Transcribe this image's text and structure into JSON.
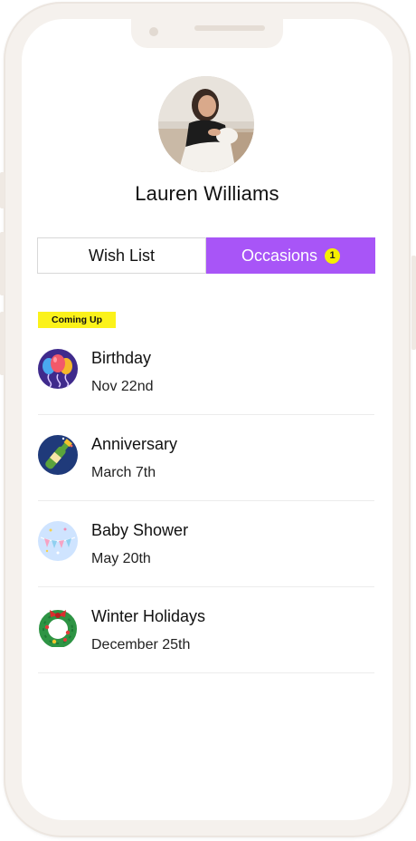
{
  "profile": {
    "name": "Lauren Williams"
  },
  "tabs": {
    "wish_list": "Wish List",
    "occasions": "Occasions",
    "occasions_badge": "1"
  },
  "section_label": "Coming Up",
  "occasions": [
    {
      "title": "Birthday",
      "date": "Nov 22nd",
      "icon": "balloons-icon"
    },
    {
      "title": "Anniversary",
      "date": "March 7th",
      "icon": "champagne-icon"
    },
    {
      "title": "Baby Shower",
      "date": "May 20th",
      "icon": "baby-banner-icon"
    },
    {
      "title": "Winter Holidays",
      "date": "December 25th",
      "icon": "wreath-icon"
    }
  ],
  "colors": {
    "accent": "#a855f7",
    "badge": "#f5ef00",
    "tag": "#fbf21a",
    "frame": "#f5f1ed"
  }
}
